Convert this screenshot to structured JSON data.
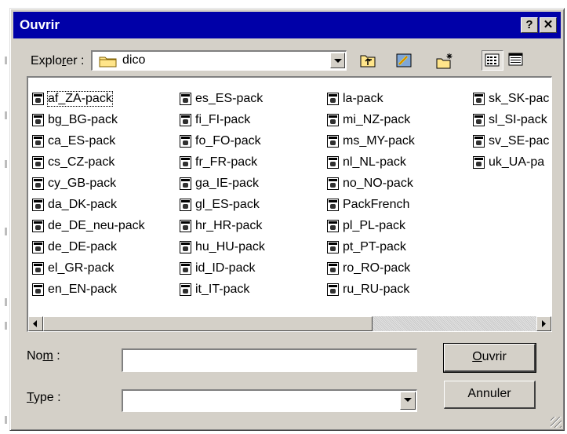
{
  "window": {
    "title": "Ouvrir",
    "help_label": "?",
    "close_label": "✕"
  },
  "lookin": {
    "label_pre": "Explo",
    "label_ul": "r",
    "label_post": "er :",
    "value": "dico"
  },
  "files": {
    "col1": [
      "af_ZA-pack",
      "bg_BG-pack",
      "ca_ES-pack",
      "cs_CZ-pack",
      "cy_GB-pack",
      "da_DK-pack",
      "de_DE_neu-pack",
      "de_DE-pack",
      "el_GR-pack",
      "en_EN-pack"
    ],
    "col2": [
      "es_ES-pack",
      "fi_FI-pack",
      "fo_FO-pack",
      "fr_FR-pack",
      "ga_IE-pack",
      "gl_ES-pack",
      "hr_HR-pack",
      "hu_HU-pack",
      "id_ID-pack",
      "it_IT-pack"
    ],
    "col3": [
      "la-pack",
      "mi_NZ-pack",
      "ms_MY-pack",
      "nl_NL-pack",
      "no_NO-pack",
      "PackFrench",
      "pl_PL-pack",
      "pt_PT-pack",
      "ro_RO-pack",
      "ru_RU-pack"
    ],
    "col4": [
      "sk_SK-pac",
      "sl_SI-pack",
      "sv_SE-pac",
      "uk_UA-pa"
    ]
  },
  "name_field": {
    "label_pre": "No",
    "label_ul": "m",
    "label_post": " :",
    "value": ""
  },
  "type_field": {
    "label_ul": "T",
    "label_post": "ype :",
    "value": ""
  },
  "buttons": {
    "open_ul": "O",
    "open_rest": "uvrir",
    "cancel": "Annuler"
  },
  "icons": [
    "folder-icon",
    "up-folder-icon",
    "desktop-icon",
    "new-folder-icon",
    "list-view-icon",
    "details-view-icon",
    "file-icon"
  ]
}
